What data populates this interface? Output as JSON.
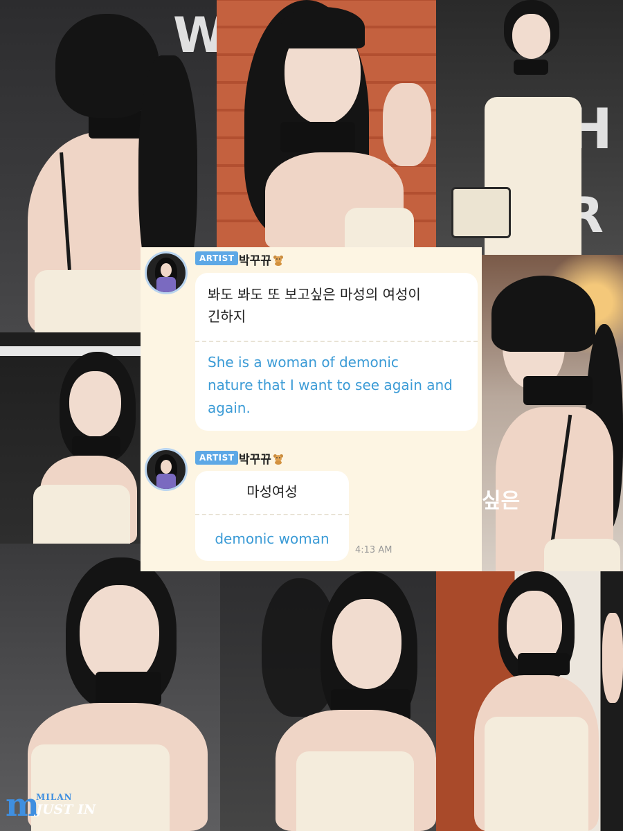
{
  "chat": {
    "messages": [
      {
        "badge": "ARTIST",
        "sender": "박꾸뀨",
        "original": "봐도 봐도 또 보고싶은 마성의 여성이 긴하지",
        "original_line1": "봐도 봐도 또 보고싶은 마성의 여성이",
        "original_line2": "긴하지",
        "translation_line1": "She is a woman of demonic",
        "translation_line2": "nature that I want to see again and",
        "translation_line3": "again."
      },
      {
        "badge": "ARTIST",
        "sender": "박꾸뀨",
        "original": "마성여성",
        "translation": "demonic woman",
        "time": "4:13 AM"
      }
    ]
  },
  "overlay_text": "싶은",
  "watermark": {
    "mark": "m",
    "top": "MILAN",
    "bottom": "JUST IN"
  },
  "colors": {
    "badge": "#5da8e6",
    "translation": "#3b9bd6",
    "card_background": "#fdf5e3",
    "watermark_blue": "#3f8fe0"
  }
}
